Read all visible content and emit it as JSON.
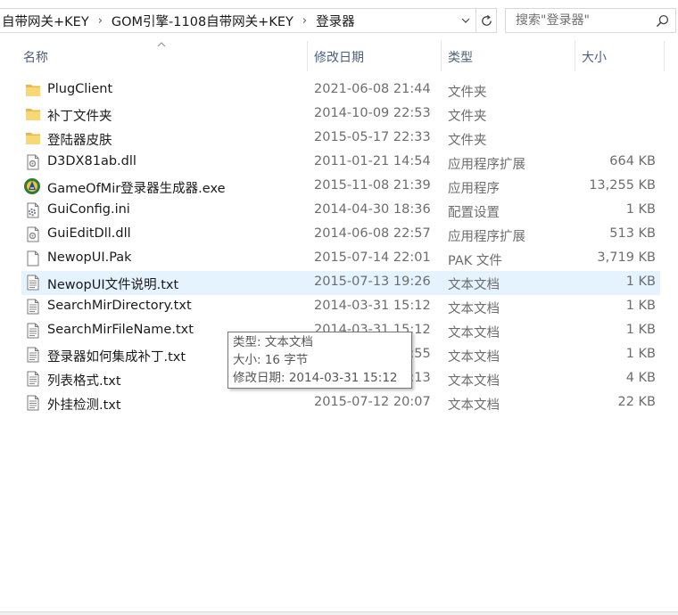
{
  "address": {
    "crumbs": [
      "自带网关+KEY",
      "GOM引擎-1108自带网关+KEY",
      "登录器"
    ],
    "separator": "›"
  },
  "search": {
    "placeholder": "搜索\"登录器\""
  },
  "columns": {
    "name": "名称",
    "date": "修改日期",
    "type": "类型",
    "size": "大小"
  },
  "files": [
    {
      "name": "PlugClient",
      "date": "2021-06-08 21:44",
      "type": "文件夹",
      "size": "",
      "icon": "folder-icon"
    },
    {
      "name": "补丁文件夹",
      "date": "2014-10-09 22:53",
      "type": "文件夹",
      "size": "",
      "icon": "folder-icon"
    },
    {
      "name": "登陆器皮肤",
      "date": "2015-05-17 22:33",
      "type": "文件夹",
      "size": "",
      "icon": "folder-icon"
    },
    {
      "name": "D3DX81ab.dll",
      "date": "2011-01-21 14:54",
      "type": "应用程序扩展",
      "size": "664 KB",
      "icon": "dll-file-icon"
    },
    {
      "name": "GameOfMir登录器生成器.exe",
      "date": "2015-11-08 21:39",
      "type": "应用程序",
      "size": "13,255 KB",
      "icon": "exe-app-icon"
    },
    {
      "name": "GuiConfig.ini",
      "date": "2014-04-30 18:36",
      "type": "配置设置",
      "size": "1 KB",
      "icon": "ini-file-icon"
    },
    {
      "name": "GuiEditDll.dll",
      "date": "2014-06-08 22:57",
      "type": "应用程序扩展",
      "size": "513 KB",
      "icon": "dll-file-icon"
    },
    {
      "name": "NewopUI.Pak",
      "date": "2015-07-14 22:01",
      "type": "PAK 文件",
      "size": "3,719 KB",
      "icon": "blank-file-icon"
    },
    {
      "name": "NewopUI文件说明.txt",
      "date": "2015-07-13 19:26",
      "type": "文本文档",
      "size": "1 KB",
      "icon": "text-file-icon"
    },
    {
      "name": "SearchMirDirectory.txt",
      "date": "2014-03-31 15:12",
      "type": "文本文档",
      "size": "1 KB",
      "icon": "text-file-icon"
    },
    {
      "name": "SearchMirFileName.txt",
      "date": "2014-03-31 15:12",
      "type": "文本文档",
      "size": "1 KB",
      "icon": "text-file-icon"
    },
    {
      "name": "登录器如何集成补丁.txt",
      "date": "2014-03-31 15:55",
      "type": "文本文档",
      "size": "1 KB",
      "icon": "text-file-icon"
    },
    {
      "name": "列表格式.txt",
      "date": "2014-03-31 15:13",
      "type": "文本文档",
      "size": "4 KB",
      "icon": "text-file-icon"
    },
    {
      "name": "外挂检测.txt",
      "date": "2015-07-12 20:07",
      "type": "文本文档",
      "size": "22 KB",
      "icon": "text-file-icon"
    }
  ],
  "hovered_row": 8,
  "tooltip": {
    "type_line": "类型: 文本文档",
    "size_line": "大小: 16 字节",
    "date_line": "修改日期: 2014-03-31 15:12"
  },
  "colors": {
    "hover": "#e5f3ff",
    "header_text": "#4c607a",
    "folder": "#f8d775"
  }
}
